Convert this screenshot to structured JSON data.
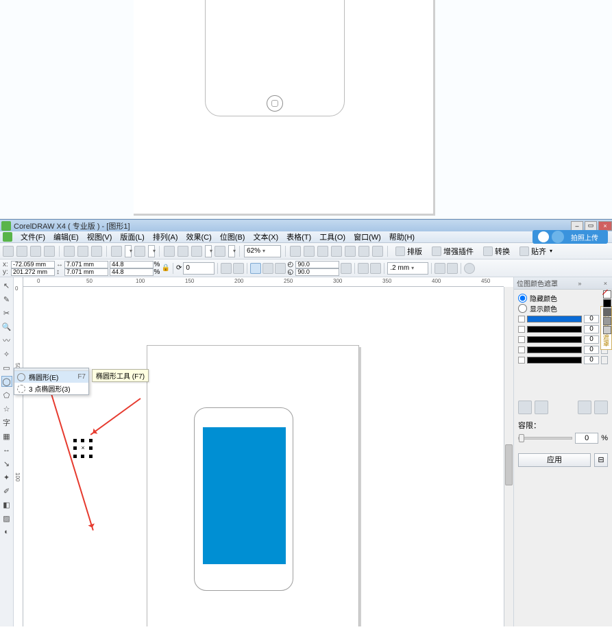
{
  "app": {
    "title": "CorelDRAW X4 ( 专业版 ) - [图形1]"
  },
  "menu": {
    "items": [
      "文件(F)",
      "编辑(E)",
      "视图(V)",
      "版面(L)",
      "排列(A)",
      "效果(C)",
      "位图(B)",
      "文本(X)",
      "表格(T)",
      "工具(O)",
      "窗口(W)",
      "帮助(H)"
    ],
    "upload_label": "拍照上传"
  },
  "toolbar1": {
    "zoom": "62%",
    "group_buttons": [
      "排版",
      "增强插件",
      "转换",
      "贴齐"
    ]
  },
  "propbar": {
    "x": "-72.059 mm",
    "y": "201.272 mm",
    "w": "7.071 mm",
    "h": "7.071 mm",
    "sx": "44.8",
    "sy": "44.8",
    "rot": "0",
    "ang1": "90.0",
    "ang2": "90.0",
    "outline": ".2 mm"
  },
  "ruler_top": [
    "0",
    "50",
    "100",
    "150",
    "200",
    "250",
    "300",
    "350",
    "400",
    "450"
  ],
  "ruler_left_top": "0",
  "ruler_left": [
    "50",
    "100"
  ],
  "flyout": {
    "item1": "椭圆形(E)",
    "item1_key": "F7",
    "item2": "3 点椭圆形(3)",
    "tooltip": "椭圆形工具 (F7)"
  },
  "toolbox": {
    "items": [
      "pick",
      "shape",
      "crop",
      "zoom",
      "freehand",
      "smart",
      "rect",
      "ellipse",
      "polygon",
      "basic",
      "text",
      "table",
      "dimension",
      "connector",
      "interactive",
      "dropper",
      "outline",
      "fill",
      "ifill"
    ],
    "selected": "ellipse",
    "glyphs": [
      "↖",
      "✎",
      "✂",
      "🔍",
      "〰",
      "✧",
      "▭",
      "◯",
      "⬠",
      "☆",
      "A",
      "▦",
      "↔",
      "↘",
      "✦",
      "✐",
      "◧",
      "▨",
      "◐"
    ],
    "text_glyph": "字"
  },
  "docker": {
    "title": "位图颜色遮罩",
    "radio1": "隐藏颜色",
    "radio2": "显示颜色",
    "swatch_vals": [
      "0",
      "0",
      "0",
      "0",
      "0"
    ],
    "opacity_label": "容限：",
    "opacity_val": "0",
    "opacity_suffix": "%",
    "apply": "应用",
    "vtab": "位图颜色遮罩"
  }
}
